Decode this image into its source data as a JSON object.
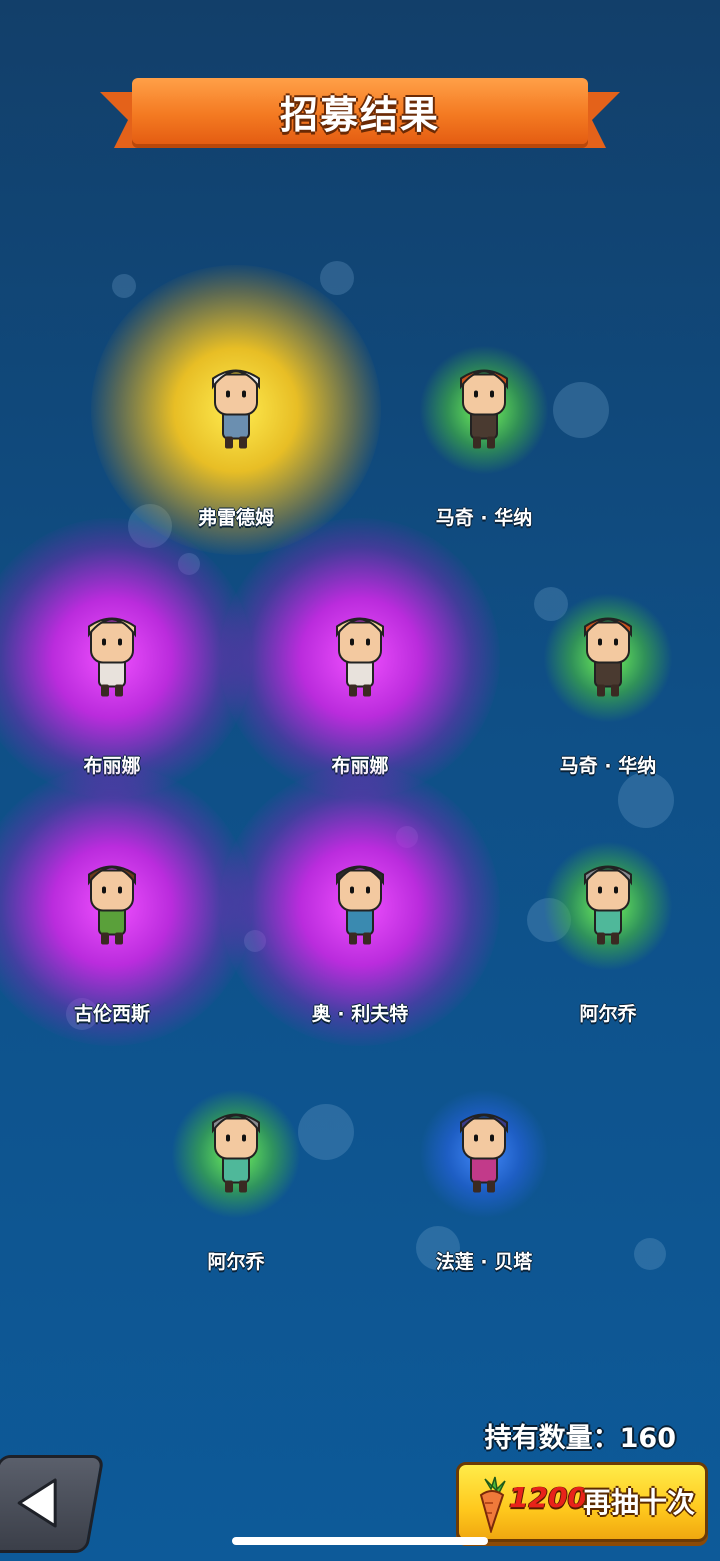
{
  "banner": {
    "title": "招募结果"
  },
  "heroes": [
    {
      "name": "弗雷德姆",
      "rarity": "gold",
      "avatar_icon": "white-haired-sage-icon",
      "hair": "#e8e8ea",
      "cloth": "#6b8fb0"
    },
    {
      "name": "马奇 · 华纳",
      "rarity": "green",
      "avatar_icon": "viking-bearded-warrior-icon",
      "hair": "#c9521e",
      "cloth": "#4a3a30"
    },
    {
      "name": "布丽娜",
      "rarity": "purple",
      "avatar_icon": "blonde-girl-icon",
      "hair": "#f1d79a",
      "cloth": "#e8e2dc"
    },
    {
      "name": "布丽娜",
      "rarity": "purple",
      "avatar_icon": "blonde-girl-icon",
      "hair": "#f1d79a",
      "cloth": "#e8e2dc"
    },
    {
      "name": "马奇 · 华纳",
      "rarity": "green",
      "avatar_icon": "viking-bearded-warrior-icon",
      "hair": "#c9521e",
      "cloth": "#4a3a30"
    },
    {
      "name": "古伦西斯",
      "rarity": "purple",
      "avatar_icon": "chef-strongman-icon",
      "hair": "#6b3a1a",
      "cloth": "#5aa03a"
    },
    {
      "name": "奥 · 利夫特",
      "rarity": "purple",
      "avatar_icon": "pirate-captain-icon",
      "hair": "#2a2a2a",
      "cloth": "#3a8ab0"
    },
    {
      "name": "阿尔乔",
      "rarity": "green",
      "avatar_icon": "helmet-soldier-icon",
      "hair": "#8a8a90",
      "cloth": "#4fb89a"
    },
    {
      "name": "阿尔乔",
      "rarity": "green",
      "avatar_icon": "helmet-soldier-icon",
      "hair": "#8a8a90",
      "cloth": "#4fb89a"
    },
    {
      "name": "法莲 · 贝塔",
      "rarity": "blue",
      "avatar_icon": "pirate-girl-icon",
      "hair": "#3a3a8a",
      "cloth": "#c23a8a"
    }
  ],
  "footer": {
    "owned_text": "持有数量：160",
    "cost": "1200",
    "redraw_label": "再抽十次",
    "carrot_icon": "carrot-icon",
    "back_icon": "back-arrow-icon"
  }
}
